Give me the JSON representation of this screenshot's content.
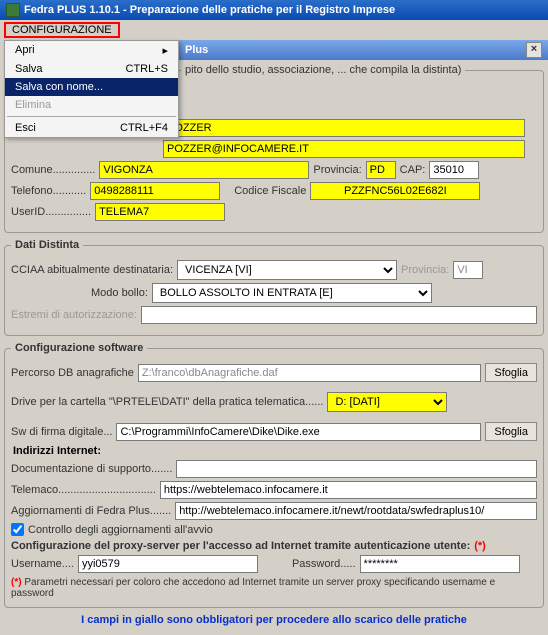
{
  "titlebar": "Fedra PLUS 1.10.1 - Preparazione delle pratiche per il Registro Imprese",
  "menubar": {
    "config": "CONFIGURAZIONE"
  },
  "dropdown": {
    "apri": "Apri",
    "salva": "Salva",
    "salva_shortcut": "CTRL+S",
    "salva_con_nome": "Salva con nome...",
    "elimina": "Elimina",
    "esci": "Esci",
    "esci_shortcut": "CTRL+F4"
  },
  "subtitle": "Plus",
  "group1_legend": "pito dello studio, associazione, ... che compila la distinta)",
  "fields": {
    "pozzer_value": "POZZER",
    "email_value": "POZZER@INFOCAMERE.IT",
    "comune_lbl": "Comune..............",
    "comune_val": "VIGONZA",
    "provincia_lbl": "Provincia:",
    "provincia_val": "PD",
    "cap_lbl": "CAP:",
    "cap_val": "35010",
    "telefono_lbl": "Telefono...........",
    "telefono_val": "0498288111",
    "cf_lbl": "Codice Fiscale",
    "cf_val": "PZZFNC56L02E682I",
    "userid_lbl": "UserID...............",
    "userid_val": "TELEMA7"
  },
  "dati_distinta": {
    "legend": "Dati Distinta",
    "cciaa_lbl": "CCIAA abitualmente destinataria:",
    "cciaa_val": "VICENZA [VI]",
    "prov_lbl": "Provincia:",
    "prov_val": "VI",
    "modo_lbl": "Modo bollo:",
    "modo_val": "BOLLO ASSOLTO IN ENTRATA [E]",
    "estremi_lbl": "Estremi di autorizzazione:",
    "estremi_val": ""
  },
  "config_sw": {
    "legend": "Configurazione software",
    "percorso_lbl": "Percorso DB anagrafiche",
    "percorso_val": "Z:\\franco\\dbAnagrafiche.daf",
    "sfoglia": "Sfoglia",
    "drive_lbl": "Drive per la cartella \"\\PRTELE\\DATI\" della pratica telematica......",
    "drive_val": "D: [DATI]",
    "sw_lbl": "Sw di firma digitale...",
    "sw_val": "C:\\Programmi\\InfoCamere\\Dike\\Dike.exe",
    "indirizzi_lbl": "Indirizzi Internet:",
    "doc_lbl": "Documentazione di supporto.......",
    "doc_val": "",
    "telemaco_lbl": "Telemaco................................",
    "telemaco_val": "https://webtelemaco.infocamere.it",
    "agg_lbl": "Aggiornamenti di Fedra Plus.......",
    "agg_val": "http://webtelemaco.infocamere.it/newt/rootdata/swfedraplus10/",
    "check_lbl": "Controllo degli aggiornamenti all'avvio"
  },
  "proxy": {
    "legend_text": "Configurazione del proxy-server per l'accesso ad Internet tramite autenticazione utente: ",
    "username_lbl": "Username....",
    "username_val": "yyi0579",
    "password_lbl": "Password.....",
    "password_val": "********",
    "footnote": "Parametri necessari per coloro che accedono ad Internet tramite un server proxy specificando username e password"
  },
  "blue_note": "I campi in giallo sono obbligatori per procedere allo scarico delle pratiche"
}
